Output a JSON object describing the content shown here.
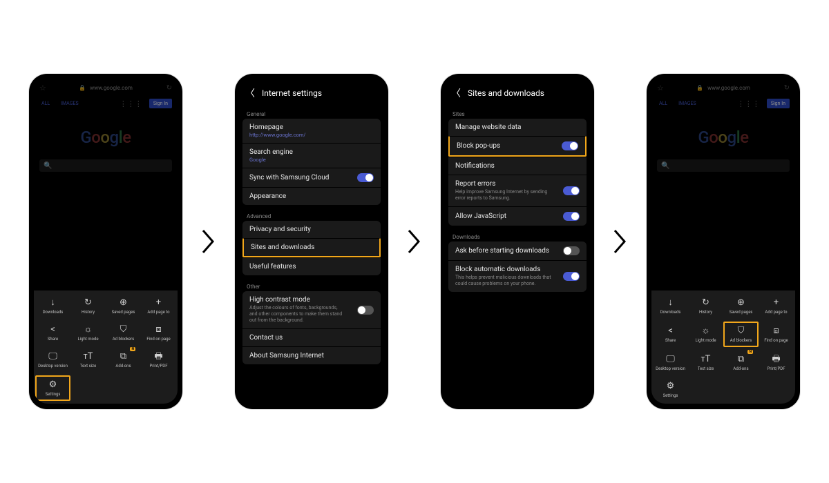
{
  "browser": {
    "url": "www.google.com",
    "lock": "🔒",
    "tabs": {
      "all": "ALL",
      "images": "IMAGES"
    },
    "signin": "Sign In",
    "logo": [
      "G",
      "o",
      "o",
      "g",
      "l",
      "e"
    ]
  },
  "menu": {
    "items": [
      {
        "key": "downloads",
        "label": "Downloads",
        "icon": "↓"
      },
      {
        "key": "history",
        "label": "History",
        "icon": "↻"
      },
      {
        "key": "saved",
        "label": "Saved pages",
        "icon": "⊕"
      },
      {
        "key": "addpage",
        "label": "Add page to",
        "icon": "+"
      },
      {
        "key": "share",
        "label": "Share",
        "icon": "<"
      },
      {
        "key": "lightmode",
        "label": "Light mode",
        "icon": "☼"
      },
      {
        "key": "adblockers",
        "label": "Ad blockers",
        "icon": "⛉"
      },
      {
        "key": "findonpage",
        "label": "Find on page",
        "icon": "⧈"
      },
      {
        "key": "desktop",
        "label": "Desktop version",
        "icon": "🖵"
      },
      {
        "key": "textsize",
        "label": "Text size",
        "icon": "ᴛT"
      },
      {
        "key": "addons",
        "label": "Add-ons",
        "icon": "⧉",
        "badge": "N"
      },
      {
        "key": "printpdf",
        "label": "Print/PDF",
        "icon": "🖶"
      },
      {
        "key": "settings",
        "label": "Settings",
        "icon": "⚙"
      }
    ]
  },
  "settings": {
    "title": "Internet settings",
    "sections": {
      "general": "General",
      "advanced": "Advanced",
      "other": "Other"
    },
    "items": {
      "homepage": {
        "label": "Homepage",
        "sub": "http://www.google.com/"
      },
      "searchengine": {
        "label": "Search engine",
        "sub": "Google"
      },
      "sync": {
        "label": "Sync with Samsung Cloud",
        "toggle": "on"
      },
      "appearance": {
        "label": "Appearance"
      },
      "privacy": {
        "label": "Privacy and security"
      },
      "sitesdl": {
        "label": "Sites and downloads"
      },
      "useful": {
        "label": "Useful features"
      },
      "highcontrast": {
        "label": "High contrast mode",
        "desc": "Adjust the colours of fonts, backgrounds, and other components to make them stand out from the background.",
        "toggle": "off"
      },
      "contact": {
        "label": "Contact us"
      },
      "about": {
        "label": "About Samsung Internet"
      }
    }
  },
  "sitesdl": {
    "title": "Sites and downloads",
    "sections": {
      "sites": "Sites",
      "downloads": "Downloads"
    },
    "items": {
      "managewd": {
        "label": "Manage website data"
      },
      "popups": {
        "label": "Block pop-ups",
        "toggle": "on"
      },
      "notif": {
        "label": "Notifications"
      },
      "report": {
        "label": "Report errors",
        "desc": "Help improve Samsung Internet by sending error reports to Samsung.",
        "toggle": "on"
      },
      "allowjs": {
        "label": "Allow JavaScript",
        "toggle": "on"
      },
      "askdl": {
        "label": "Ask before starting downloads",
        "toggle": "off"
      },
      "blockauto": {
        "label": "Block automatic downloads",
        "desc": "This helps prevent malicious downloads that could cause problems on your phone.",
        "toggle": "on"
      }
    }
  }
}
